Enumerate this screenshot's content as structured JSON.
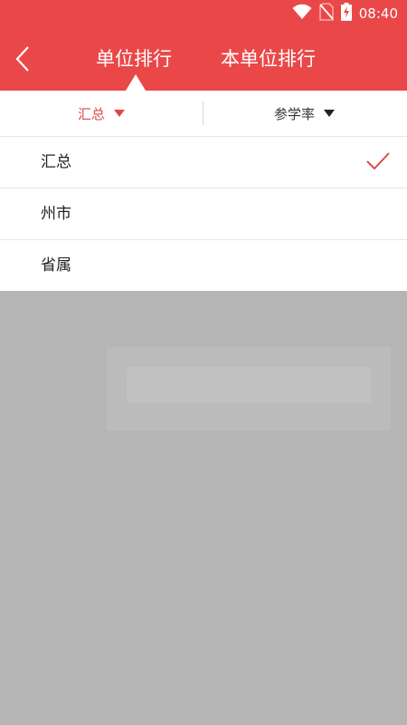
{
  "status_bar": {
    "time": "08:40",
    "icons": [
      "wifi-icon",
      "no-sim-icon",
      "battery-charging-icon"
    ]
  },
  "header": {
    "back_icon": "chevron-left-icon",
    "tabs": [
      {
        "label": "单位排行",
        "active": true
      },
      {
        "label": "本单位排行",
        "active": false
      }
    ]
  },
  "filters": {
    "region": {
      "label": "汇总",
      "active": true,
      "icon": "caret-down-icon"
    },
    "metric": {
      "label": "参学率",
      "active": false,
      "icon": "caret-down-icon"
    }
  },
  "dropdown": {
    "options": [
      {
        "label": "汇总",
        "selected": true
      },
      {
        "label": "州市",
        "selected": false
      },
      {
        "label": "省属",
        "selected": false
      }
    ],
    "check_icon": "checkmark-icon"
  },
  "colors": {
    "accent": "#ea4848",
    "active_text": "#e04848",
    "overlay": "#b5b5b5"
  }
}
